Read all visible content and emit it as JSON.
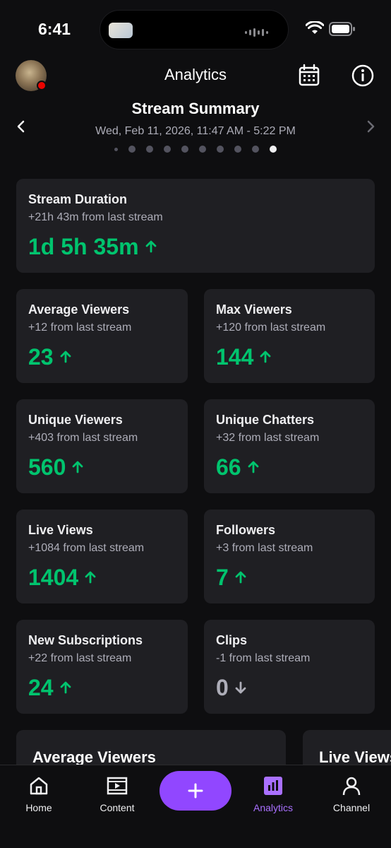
{
  "status_bar": {
    "time": "6:41"
  },
  "header": {
    "title": "Analytics"
  },
  "summary": {
    "title": "Stream Summary",
    "date_range": "Wed, Feb 11, 2026, 11:47 AM - 5:22 PM",
    "pager_total": 10,
    "pager_active_index": 9
  },
  "cards": [
    {
      "title": "Stream Duration",
      "sub": "+21h 43m from last stream",
      "value": "1d 5h 35m",
      "trend": "up"
    },
    {
      "title": "Average Viewers",
      "sub": "+12 from last stream",
      "value": "23",
      "trend": "up"
    },
    {
      "title": "Max Viewers",
      "sub": "+120 from last stream",
      "value": "144",
      "trend": "up"
    },
    {
      "title": "Unique Viewers",
      "sub": "+403 from last stream",
      "value": "560",
      "trend": "up"
    },
    {
      "title": "Unique Chatters",
      "sub": "+32 from last stream",
      "value": "66",
      "trend": "up"
    },
    {
      "title": "Live Views",
      "sub": "+1084 from last stream",
      "value": "1404",
      "trend": "up"
    },
    {
      "title": "Followers",
      "sub": "+3 from last stream",
      "value": "7",
      "trend": "up"
    },
    {
      "title": "New Subscriptions",
      "sub": "+22 from last stream",
      "value": "24",
      "trend": "up"
    },
    {
      "title": "Clips",
      "sub": "-1 from last stream",
      "value": "0",
      "trend": "down"
    }
  ],
  "chart_cards": [
    {
      "title": "Average Viewers"
    },
    {
      "title": "Live Views"
    }
  ],
  "tab_bar": {
    "home": "Home",
    "content": "Content",
    "analytics": "Analytics",
    "channel": "Channel"
  },
  "colors": {
    "background": "#0e0e10",
    "card": "#1f1f23",
    "positive": "#00c46e",
    "accent": "#9147ff",
    "accent_text": "#a970ff",
    "muted": "#adadb8",
    "live_dot": "#eb0400"
  },
  "icons": {
    "calendar": "calendar-icon",
    "info": "info-icon",
    "prev": "chevron-left-icon",
    "next": "chevron-right-icon",
    "up": "arrow-up-icon",
    "down": "arrow-down-icon",
    "home": "home-icon",
    "content": "content-icon",
    "create": "plus-icon",
    "analytics": "analytics-icon",
    "channel": "person-icon"
  }
}
